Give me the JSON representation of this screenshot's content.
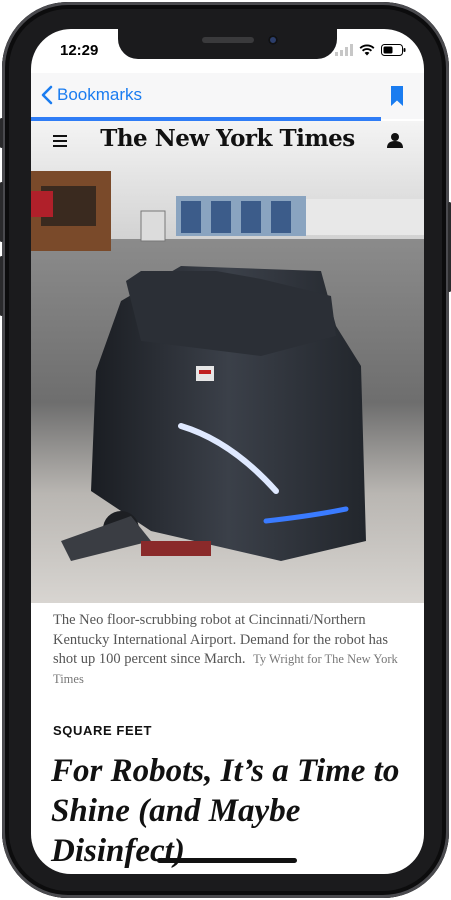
{
  "status_bar": {
    "time": "12:29"
  },
  "nav": {
    "back_label": "Bookmarks"
  },
  "header": {
    "logo": "The New York Times"
  },
  "article": {
    "caption": "The Neo floor-scrubbing robot at Cincinnati/Northern Kentucky International Airport. Demand for the robot has shot up 100 percent since March.",
    "credit": "Ty Wright for The New York Times",
    "kicker": "SQUARE FEET",
    "headline": "For Robots, It’s a Time to Shine (and Maybe Disinfect)"
  },
  "icons": {
    "back": "chevron-left-icon",
    "bookmark": "bookmark-icon",
    "menu": "hamburger-menu-icon",
    "account": "user-icon",
    "signal": "signal-icon",
    "wifi": "wifi-icon",
    "battery": "battery-icon"
  },
  "colors": {
    "accent": "#1a7cf0",
    "progress": "#2f7df6",
    "text": "#111111",
    "caption": "#555555"
  }
}
